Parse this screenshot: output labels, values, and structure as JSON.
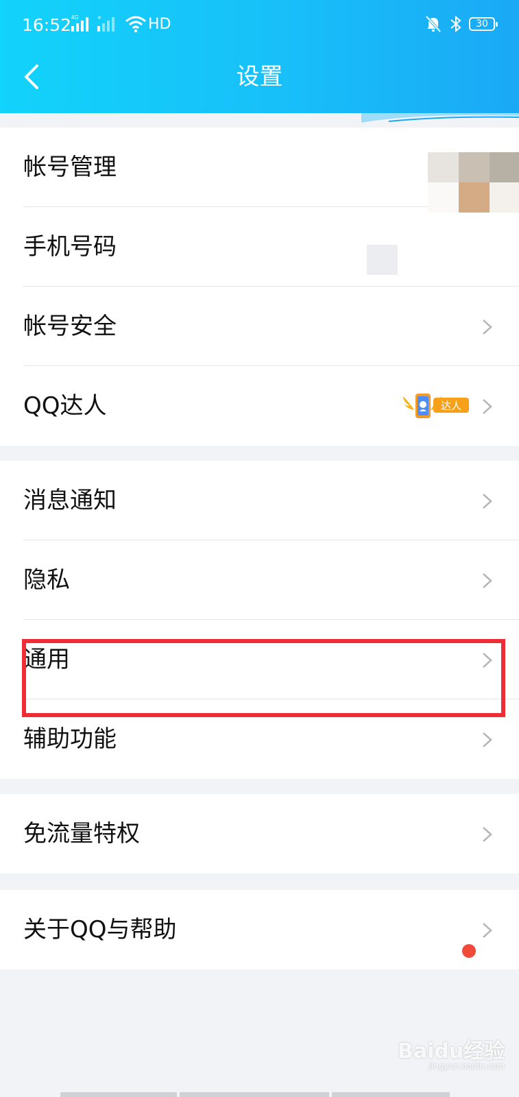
{
  "status_bar": {
    "time": "16:52",
    "network_label": "4G",
    "wifi_label": "HD",
    "battery": "30"
  },
  "header": {
    "title": "设置"
  },
  "groups": [
    {
      "rows": [
        {
          "label": "帐号管理",
          "chevron": false
        },
        {
          "label": "手机号码",
          "chevron": false
        },
        {
          "label": "帐号安全",
          "chevron": true
        },
        {
          "label": "QQ达人",
          "chevron": true,
          "badge": "达人"
        }
      ]
    },
    {
      "rows": [
        {
          "label": "消息通知",
          "chevron": true
        },
        {
          "label": "隐私",
          "chevron": true
        },
        {
          "label": "通用",
          "chevron": true,
          "highlighted": true
        },
        {
          "label": "辅助功能",
          "chevron": true
        }
      ]
    },
    {
      "rows": [
        {
          "label": "免流量特权",
          "chevron": true
        }
      ]
    },
    {
      "rows": [
        {
          "label": "关于QQ与帮助",
          "chevron": true,
          "red_dot": true
        }
      ]
    }
  ],
  "watermark": {
    "text": "Baidu经验",
    "sub": "jingyan.baidu.com"
  },
  "colors": {
    "header_start": "#12d3fb",
    "header_end": "#1aa9f5",
    "highlight": "#ee2d37",
    "red_dot": "#f04a3a"
  },
  "icons": [
    "back-arrow-icon",
    "chevron-right-icon",
    "wifi-icon",
    "mute-icon",
    "bluetooth-icon",
    "battery-icon"
  ]
}
